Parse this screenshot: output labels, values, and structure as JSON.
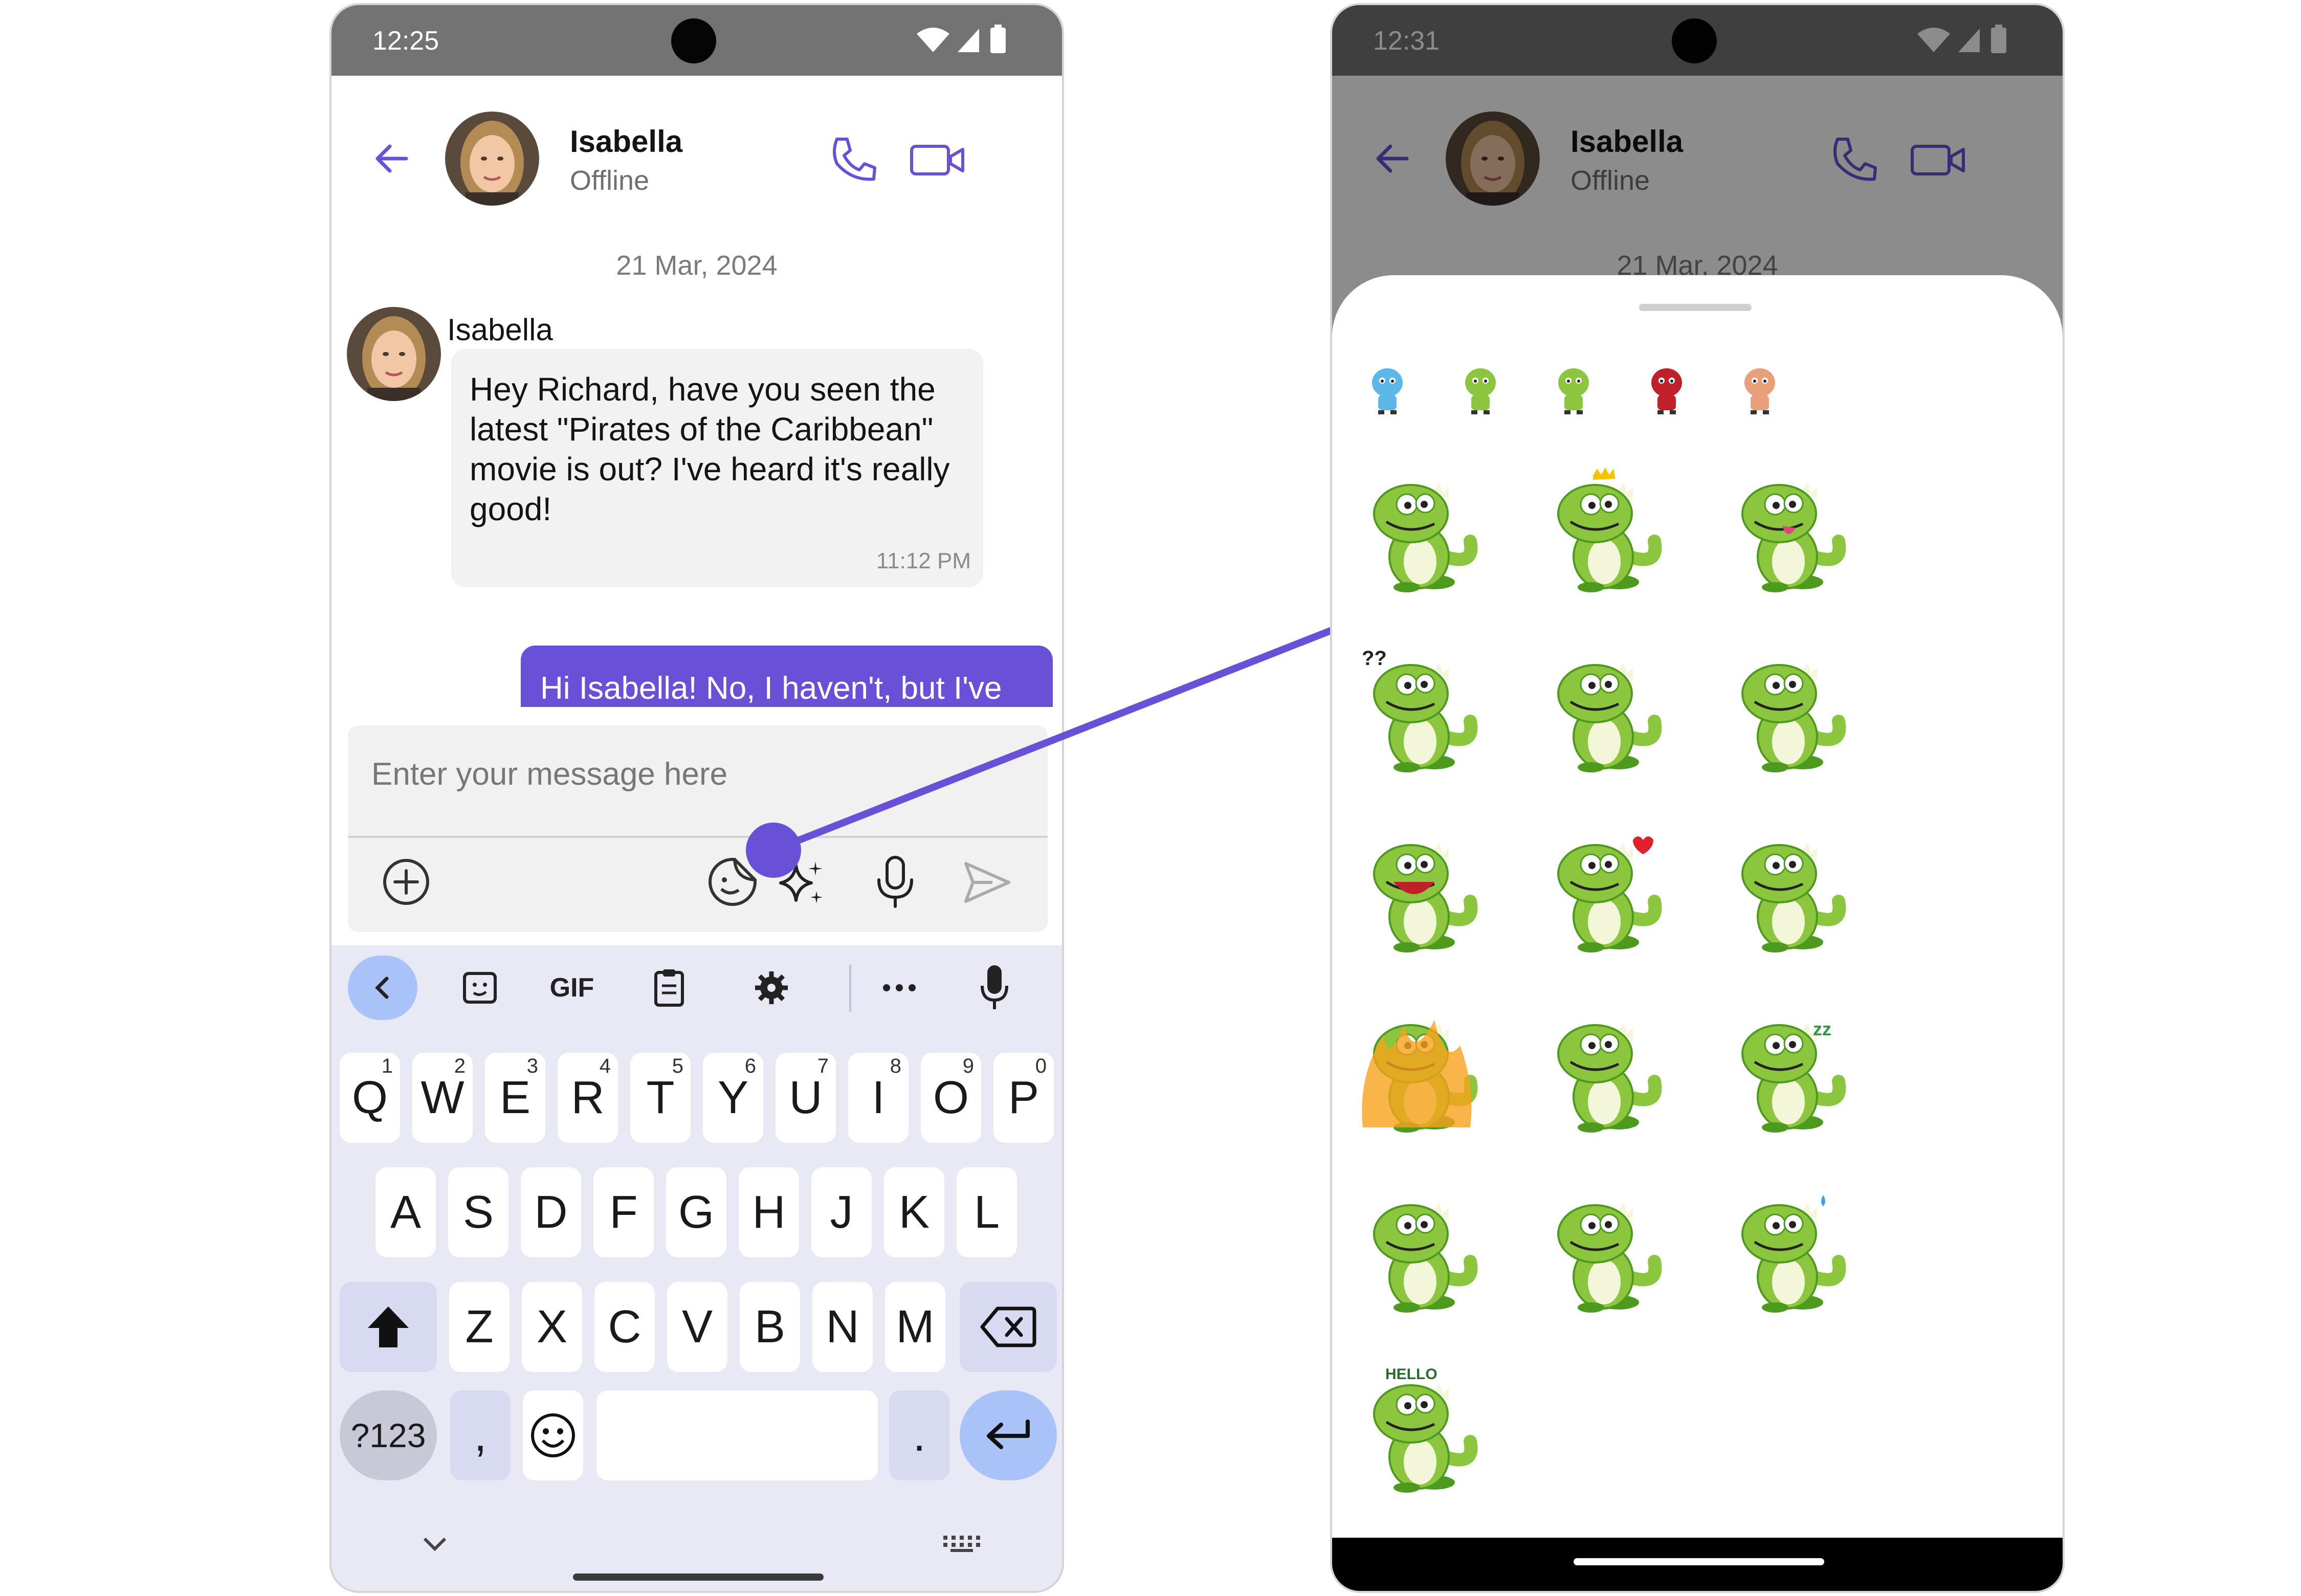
{
  "left_phone": {
    "status_time": "12:25",
    "header": {
      "name": "Isabella",
      "status": "Offline"
    },
    "date_separator": "21 Mar, 2024",
    "incoming": {
      "sender": "Isabella",
      "text": "Hey Richard, have you seen the latest \"Pirates of the Caribbean\" movie is out? I've heard it's really good!",
      "time": "11:12 PM"
    },
    "outgoing": {
      "text": "Hi Isabella! No, I haven't, but I've"
    },
    "composer": {
      "placeholder": "Enter your message here"
    },
    "keyboard": {
      "toolbar": {
        "gif": "GIF"
      },
      "row1": [
        {
          "k": "Q",
          "n": "1"
        },
        {
          "k": "W",
          "n": "2"
        },
        {
          "k": "E",
          "n": "3"
        },
        {
          "k": "R",
          "n": "4"
        },
        {
          "k": "T",
          "n": "5"
        },
        {
          "k": "Y",
          "n": "6"
        },
        {
          "k": "U",
          "n": "7"
        },
        {
          "k": "I",
          "n": "8"
        },
        {
          "k": "O",
          "n": "9"
        },
        {
          "k": "P",
          "n": "0"
        }
      ],
      "row2": [
        "A",
        "S",
        "D",
        "F",
        "G",
        "H",
        "J",
        "K",
        "L"
      ],
      "row3": [
        "Z",
        "X",
        "C",
        "V",
        "B",
        "N",
        "M"
      ],
      "symbols_key": "?123",
      "comma_key": ",",
      "period_key": "."
    }
  },
  "right_phone": {
    "status_time": "12:31",
    "header": {
      "name": "Isabella",
      "status": "Offline"
    },
    "date_separator": "21 Mar, 2024",
    "sticker_categories": [
      "cartoon-dog-icon",
      "dino-icon",
      "dino-boy-icon",
      "pirate-icon",
      "pirate-boy-icon"
    ],
    "sticker_grid": [
      "dino-happy",
      "dino-crown",
      "dino-tongue",
      "dino-confused",
      "dino-thinking",
      "dino-annoyed",
      "dino-laughing",
      "dino-love",
      "dino-sad",
      "dino-angry-fire",
      "dino-dizzy",
      "dino-sleeping",
      "dino-grumpy",
      "dino-frown",
      "dino-sweat",
      "dino-hello"
    ],
    "sticker_hello_text": "HELLO"
  },
  "colors": {
    "accent": "#6851d6",
    "dino": "#8cc63f",
    "dino_dark": "#4e9a1f"
  }
}
